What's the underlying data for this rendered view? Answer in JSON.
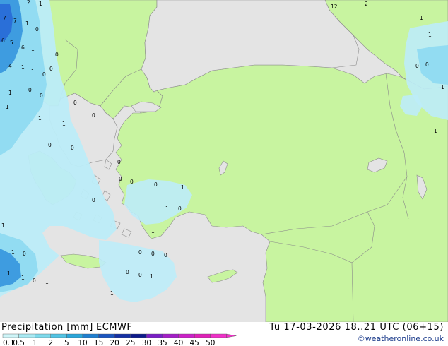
{
  "footer": {
    "title": "Precipitation [mm]",
    "model": "ECMWF",
    "valid_time": "Tu 17-03-2026 18..21 UTC (06+15)",
    "credit": "©weatheronline.co.uk"
  },
  "legend": {
    "ticks": [
      "0.1",
      "0.5",
      "1",
      "2",
      "5",
      "10",
      "15",
      "20",
      "25",
      "30",
      "35",
      "40",
      "45",
      "50"
    ],
    "colors": [
      "#cff5f8",
      "#a9eaf3",
      "#7edaec",
      "#52c4e4",
      "#2aa6da",
      "#1e7fd0",
      "#1a55c0",
      "#1430a4",
      "#0d1a8a",
      "#7a1ec6",
      "#a41ec8",
      "#cc20c8",
      "#e020b8",
      "#f030c8"
    ]
  },
  "map": {
    "sea_color": "#e4e4e4",
    "land_color": "#c8f4a0",
    "light_precip_color": "#bcecf8",
    "medium_precip_color": "#92dcf2",
    "heavy_precip_color": "#3e9ce0",
    "very_heavy_precip_color": "#2a6fd8",
    "value_labels": [
      "2",
      "1",
      "7",
      "7",
      "1",
      "6",
      "5",
      "6",
      "1",
      "0",
      "4",
      "1",
      "1",
      "0",
      "0",
      "1",
      "0",
      "1",
      "1",
      "1",
      "0",
      "0",
      "0",
      "0",
      "0",
      "1",
      "0",
      "1",
      "0",
      "1",
      "1",
      "0",
      "0",
      "0",
      "0",
      "0",
      "1",
      "1",
      "1",
      "0",
      "1",
      "1",
      "0",
      "1",
      "12",
      "2",
      "1",
      "0",
      "0",
      "1",
      "1",
      "1",
      "0",
      "0",
      "0",
      "0",
      "0"
    ]
  }
}
